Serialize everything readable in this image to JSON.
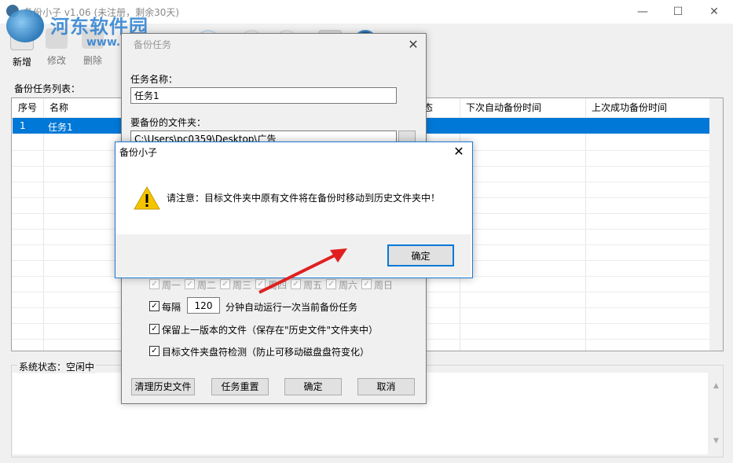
{
  "window": {
    "title": "备份小子 v1.06  (未注册，剩余30天)",
    "min": "—",
    "max": "☐",
    "close": "✕"
  },
  "watermark": {
    "name": "河东软件园",
    "url": "www.pc0359.cn"
  },
  "toolbar": {
    "new": "新增",
    "edit": "修改",
    "delete": "删除"
  },
  "list": {
    "label": "备份任务列表：",
    "columns": [
      "序号",
      "名称",
      "态",
      "下次自动备份时间",
      "上次成功备份时间"
    ],
    "rows": [
      {
        "index": "1",
        "name": "任务1"
      }
    ]
  },
  "status": {
    "label": "系统状态：空闲中"
  },
  "task_dialog": {
    "title": "备份任务",
    "close": "✕",
    "name_label": "任务名称：",
    "name_value": "任务1",
    "folder_label": "要备份的文件夹：",
    "folder_value": "C:\\Users\\pc0359\\Desktop\\广告",
    "days": [
      "周一",
      "周二",
      "周三",
      "周四",
      "周五",
      "周六",
      "周日"
    ],
    "interval_prefix": "每隔",
    "interval_value": "120",
    "interval_suffix": "分钟自动运行一次当前备份任务",
    "keep_version": "保留上一版本的文件（保存在\"历史文件\"文件夹中）",
    "drive_check": "目标文件夹盘符检测（防止可移动磁盘盘符变化）",
    "btn_clear": "清理历史文件",
    "btn_reset": "任务重置",
    "btn_ok": "确定",
    "btn_cancel": "取消",
    "check_mark": "✓"
  },
  "alert": {
    "title": "备份小子",
    "close": "✕",
    "message": "请注意：目标文件夹中原有文件将在备份时移动到历史文件夹中！",
    "ok": "确定"
  },
  "colors": {
    "accent": "#0078d7",
    "warning": "#f5c400",
    "arrow": "#e02020"
  }
}
